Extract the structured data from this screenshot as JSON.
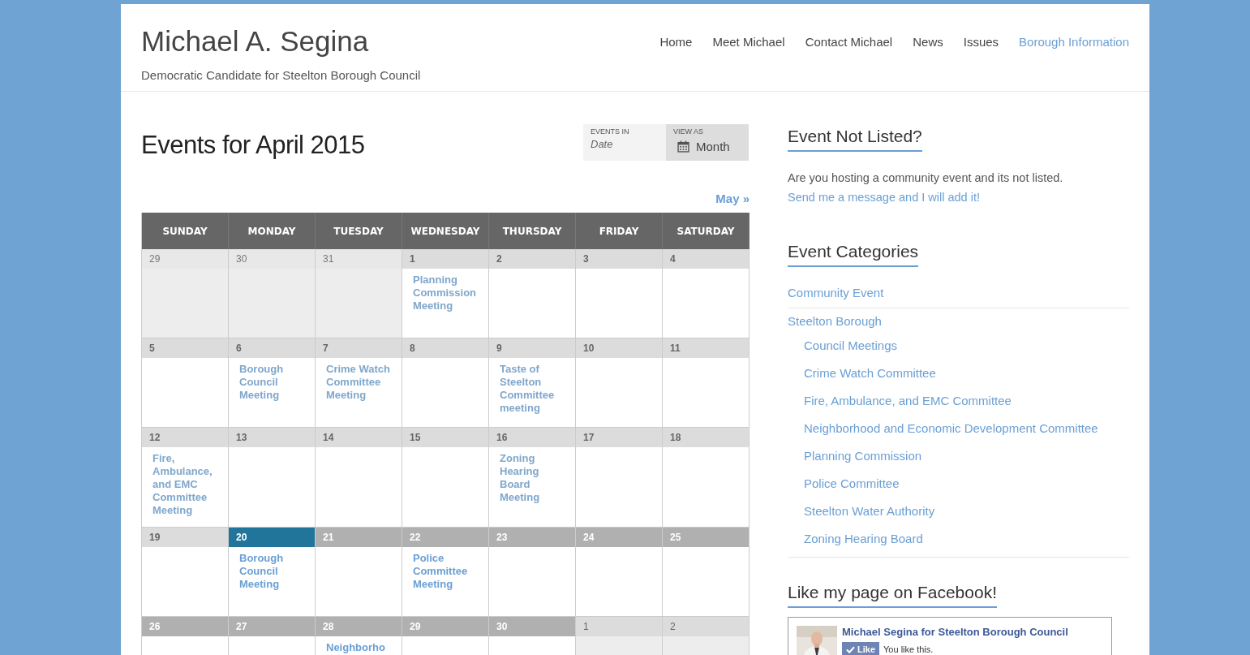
{
  "site": {
    "title": "Michael A. Segina",
    "tagline": "Democratic Candidate for Steelton Borough Council"
  },
  "nav": [
    {
      "label": "Home",
      "selected": false
    },
    {
      "label": "Meet Michael",
      "selected": false
    },
    {
      "label": "Contact Michael",
      "selected": false
    },
    {
      "label": "News",
      "selected": false
    },
    {
      "label": "Issues",
      "selected": false
    },
    {
      "label": "Borough Information",
      "selected": true
    }
  ],
  "page_title": "Events for April 2015",
  "filters": [
    {
      "label": "EVENTS IN",
      "value": "Date",
      "kind": "field"
    },
    {
      "label": "VIEW AS",
      "value": "Month",
      "kind": "select"
    }
  ],
  "next_link": "May »",
  "calendar": {
    "columns": [
      "SUNDAY",
      "MONDAY",
      "TUESDAY",
      "WEDNESDAY",
      "THURSDAY",
      "FRIDAY",
      "SATURDAY"
    ],
    "weeks": [
      [
        {
          "day": "29",
          "kind": "past",
          "other_month": true
        },
        {
          "day": "30",
          "kind": "past",
          "other_month": true
        },
        {
          "day": "31",
          "kind": "past",
          "other_month": true
        },
        {
          "day": "1",
          "kind": "past",
          "other_month": false,
          "events": [
            "Planning Commission Meeting"
          ]
        },
        {
          "day": "2",
          "kind": "past",
          "other_month": false
        },
        {
          "day": "3",
          "kind": "past",
          "other_month": false
        },
        {
          "day": "4",
          "kind": "past",
          "other_month": false
        }
      ],
      [
        {
          "day": "5",
          "kind": "past",
          "other_month": false
        },
        {
          "day": "6",
          "kind": "past",
          "other_month": false,
          "events": [
            "Borough Council Meeting"
          ]
        },
        {
          "day": "7",
          "kind": "past",
          "other_month": false,
          "events": [
            "Crime Watch Committee Meeting"
          ]
        },
        {
          "day": "8",
          "kind": "past",
          "other_month": false
        },
        {
          "day": "9",
          "kind": "past",
          "other_month": false,
          "events": [
            "Taste of Steelton Committee meeting"
          ]
        },
        {
          "day": "10",
          "kind": "past",
          "other_month": false
        },
        {
          "day": "11",
          "kind": "past",
          "other_month": false
        }
      ],
      [
        {
          "day": "12",
          "kind": "past",
          "other_month": false,
          "events": [
            "Fire, Ambulance, and EMC Committee Meeting"
          ]
        },
        {
          "day": "13",
          "kind": "past",
          "other_month": false
        },
        {
          "day": "14",
          "kind": "past",
          "other_month": false
        },
        {
          "day": "15",
          "kind": "past",
          "other_month": false
        },
        {
          "day": "16",
          "kind": "past",
          "other_month": false,
          "events": [
            "Zoning Hearing Board Meeting"
          ]
        },
        {
          "day": "17",
          "kind": "past",
          "other_month": false
        },
        {
          "day": "18",
          "kind": "past",
          "other_month": false
        }
      ],
      [
        {
          "day": "19",
          "kind": "past",
          "other_month": false
        },
        {
          "day": "20",
          "kind": "today",
          "other_month": false,
          "events": [
            "Borough Council Meeting"
          ]
        },
        {
          "day": "21",
          "kind": "future",
          "other_month": false
        },
        {
          "day": "22",
          "kind": "future",
          "other_month": false,
          "events": [
            "Police Committee Meeting"
          ]
        },
        {
          "day": "23",
          "kind": "future",
          "other_month": false
        },
        {
          "day": "24",
          "kind": "future",
          "other_month": false
        },
        {
          "day": "25",
          "kind": "future",
          "other_month": false
        }
      ],
      [
        {
          "day": "26",
          "kind": "future",
          "other_month": false
        },
        {
          "day": "27",
          "kind": "future",
          "other_month": false
        },
        {
          "day": "28",
          "kind": "future",
          "other_month": false,
          "events": [
            "Neighborho"
          ]
        },
        {
          "day": "29",
          "kind": "future",
          "other_month": false
        },
        {
          "day": "30",
          "kind": "future",
          "other_month": false
        },
        {
          "day": "1",
          "kind": "future",
          "other_month": true
        },
        {
          "day": "2",
          "kind": "future",
          "other_month": true
        }
      ]
    ]
  },
  "sidebar": {
    "not_listed": {
      "heading": "Event Not Listed?",
      "text": "Are you hosting a community event and its not listed.",
      "link": "Send me a message and I will add it!"
    },
    "categories": {
      "heading": "Event Categories",
      "items": [
        {
          "label": "Community Event"
        },
        {
          "label": "Steelton Borough",
          "children": [
            {
              "label": "Council Meetings"
            },
            {
              "label": "Crime Watch Committee"
            },
            {
              "label": "Fire, Ambulance, and EMC Committee"
            },
            {
              "label": "Neighborhood and Economic Development Committee"
            },
            {
              "label": "Planning Commission"
            },
            {
              "label": "Police Committee"
            },
            {
              "label": "Steelton Water Authority"
            },
            {
              "label": "Zoning Hearing Board"
            }
          ]
        }
      ]
    },
    "facebook": {
      "heading": "Like my page on Facebook!",
      "page_name": "Michael Segina for Steelton Borough Council",
      "like_button": "Like",
      "liked": true,
      "status": "You like this."
    }
  }
}
